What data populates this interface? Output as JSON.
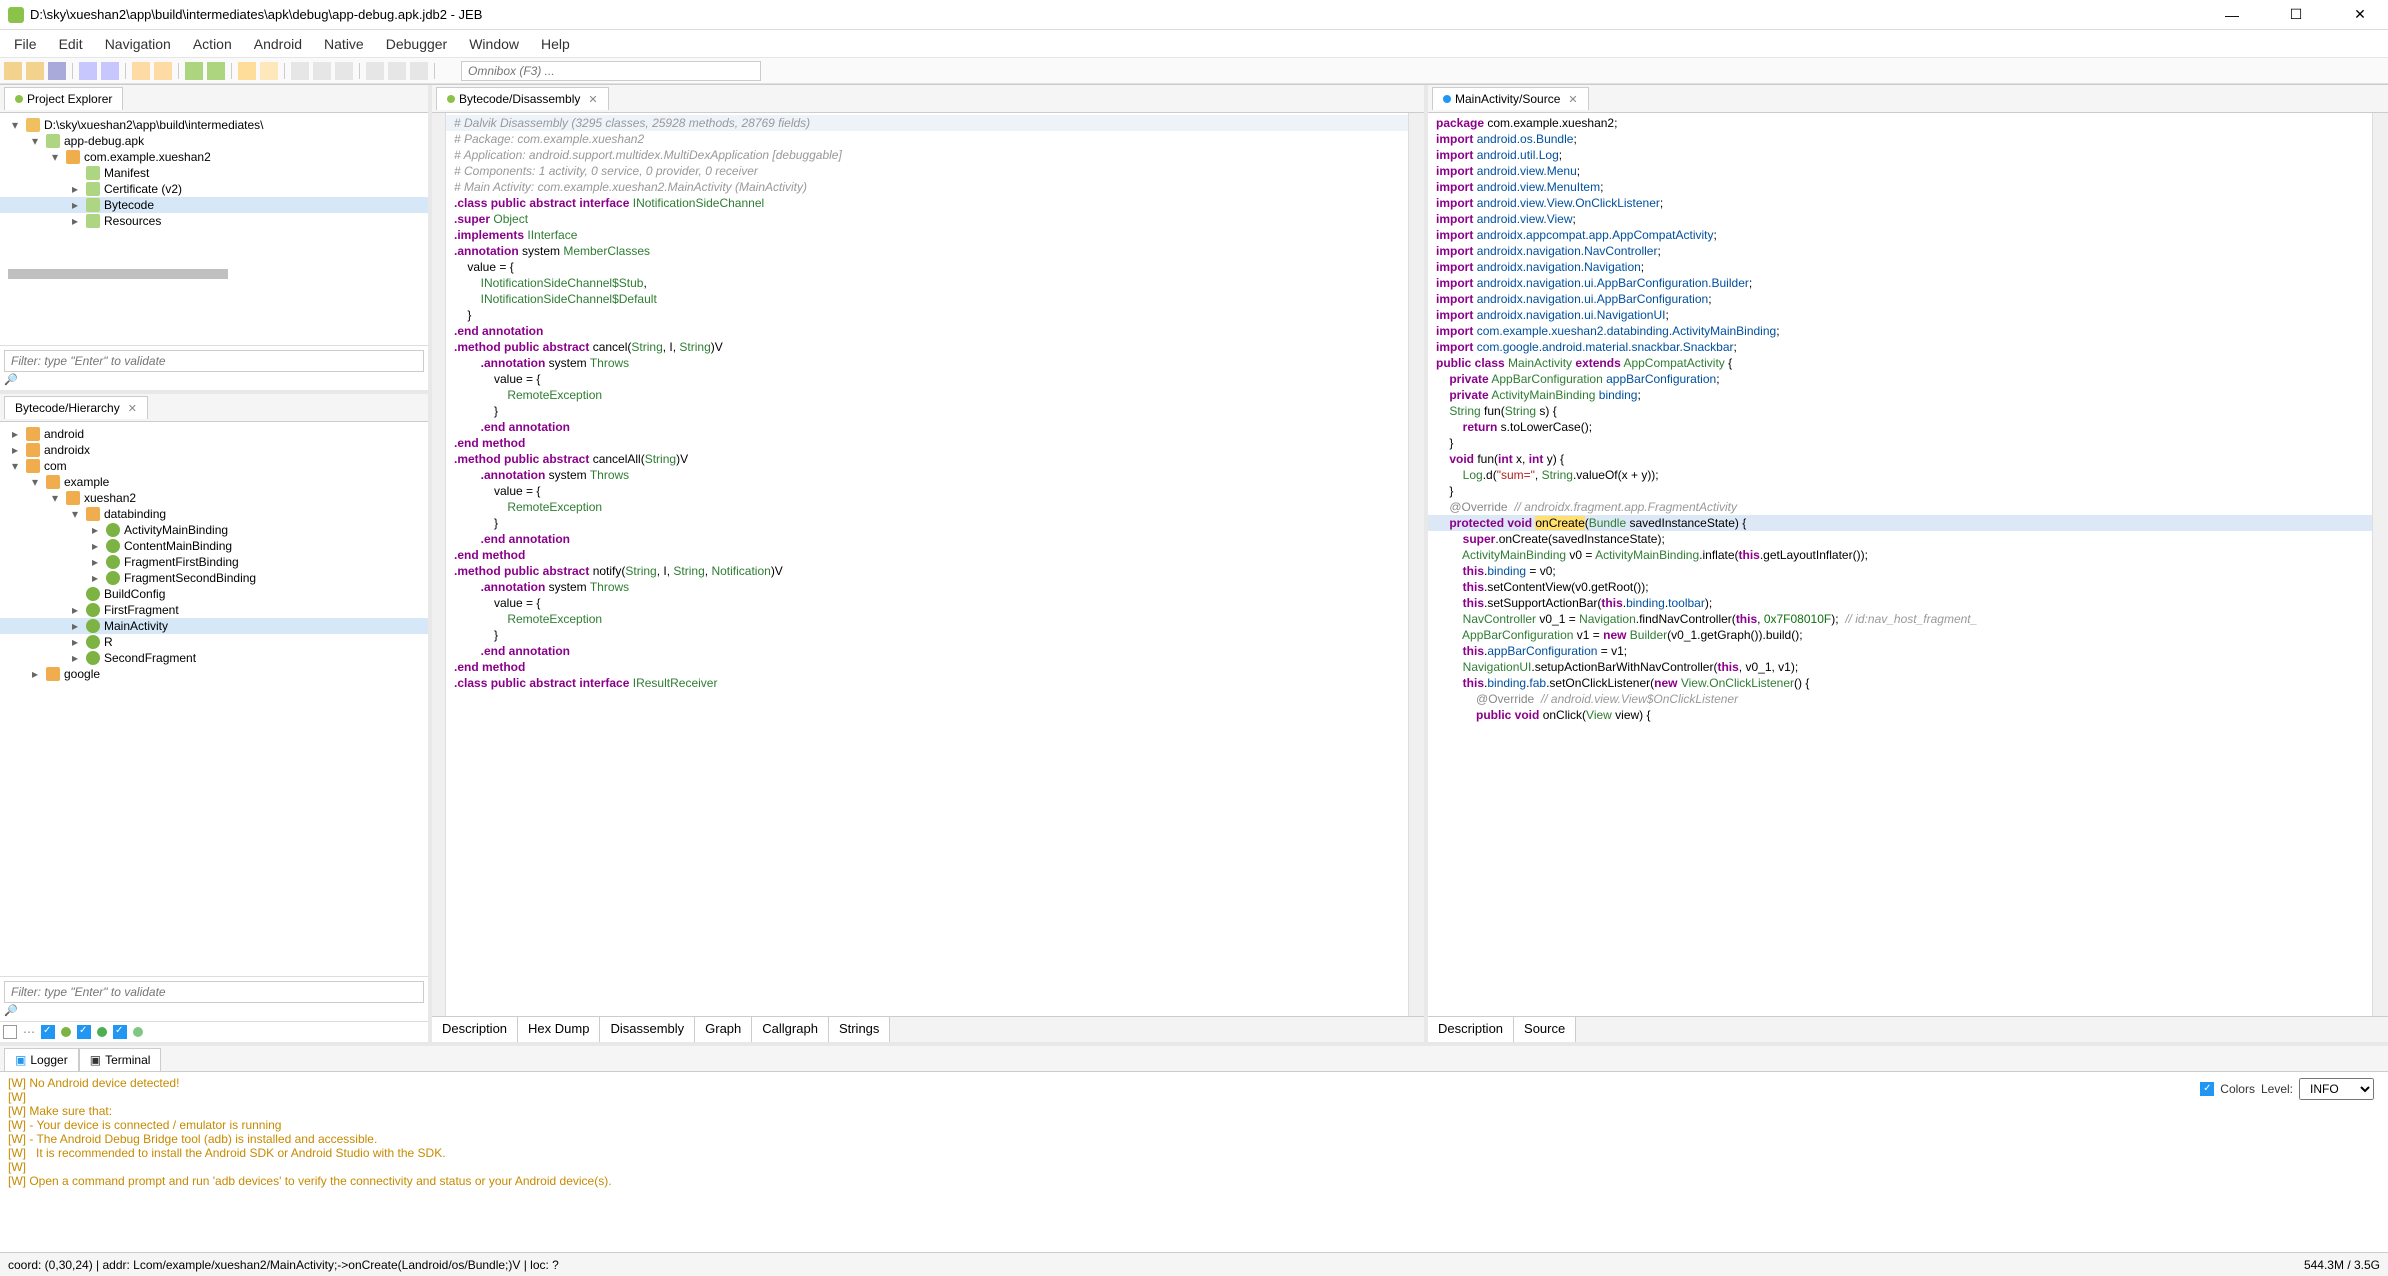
{
  "window": {
    "title": "D:\\sky\\xueshan2\\app\\build\\intermediates\\apk\\debug\\app-debug.apk.jdb2 - JEB"
  },
  "menu": [
    "File",
    "Edit",
    "Navigation",
    "Action",
    "Android",
    "Native",
    "Debugger",
    "Window",
    "Help"
  ],
  "omnibox_placeholder": "Omnibox (F3) ...",
  "panes": {
    "project_explorer": "Project Explorer",
    "bytecode_hier": "Bytecode/Hierarchy",
    "bytecode_dis": "Bytecode/Disassembly",
    "main_src": "MainActivity/Source"
  },
  "explorer_tree": {
    "root": "D:\\sky\\xueshan2\\app\\build\\intermediates\\",
    "apk": "app-debug.apk",
    "pkg": "com.example.xueshan2",
    "items": [
      "Manifest",
      "Certificate (v2)",
      "Bytecode",
      "Resources"
    ],
    "selected": "Bytecode"
  },
  "filter_placeholder": "Filter: type \"Enter\" to validate",
  "hierarchy": {
    "top": [
      "android",
      "androidx",
      "com"
    ],
    "com": [
      "example",
      "google"
    ],
    "example": [
      "xueshan2"
    ],
    "xueshan2": [
      "databinding",
      "BuildConfig",
      "FirstFragment",
      "MainActivity",
      "R",
      "SecondFragment"
    ],
    "databinding": [
      "ActivityMainBinding",
      "ContentMainBinding",
      "FragmentFirstBinding",
      "FragmentSecondBinding"
    ],
    "selected": "MainActivity"
  },
  "bottom_tabs_mid": [
    "Description",
    "Hex Dump",
    "Disassembly",
    "Graph",
    "Callgraph",
    "Strings"
  ],
  "bottom_tabs_right": [
    "Description",
    "Source"
  ],
  "logger": {
    "tabs": [
      "Logger",
      "Terminal"
    ],
    "colors_label": "Colors",
    "level_label": "Level:",
    "level_value": "INFO",
    "lines": [
      "[W] No Android device detected!",
      "[W]",
      "[W] Make sure that:",
      "[W] - Your device is connected / emulator is running",
      "[W] - The Android Debug Bridge tool (adb) is installed and accessible.",
      "[W]   It is recommended to install the Android SDK or Android Studio with the SDK.",
      "[W]",
      "[W] Open a command prompt and run 'adb devices' to verify the connectivity and status or your Android device(s)."
    ]
  },
  "status": {
    "left": "coord: (0,30,24) | addr: Lcom/example/xueshan2/MainActivity;->onCreate(Landroid/os/Bundle;)V | loc: ?",
    "right": "544.3M / 3.5G"
  },
  "disassembly_meta": [
    "# Dalvik Disassembly (3295 classes, 25928 methods, 28769 fields)",
    "# Package: com.example.xueshan2",
    "# Application: android.support.multidex.MultiDexApplication [debuggable]",
    "# Components: 1 activity, 0 service, 0 provider, 0 receiver",
    "# Main Activity: com.example.xueshan2.MainActivity (MainActivity)"
  ],
  "source_pkg": "com.example.xueshan2",
  "imports": [
    "android.os.Bundle",
    "android.util.Log",
    "android.view.Menu",
    "android.view.MenuItem",
    "android.view.View.OnClickListener",
    "android.view.View",
    "androidx.appcompat.app.AppCompatActivity",
    "androidx.navigation.NavController",
    "androidx.navigation.Navigation",
    "androidx.navigation.ui.AppBarConfiguration.Builder",
    "androidx.navigation.ui.AppBarConfiguration",
    "androidx.navigation.ui.NavigationUI",
    "com.example.xueshan2.databinding.ActivityMainBinding",
    "com.google.android.material.snackbar.Snackbar"
  ]
}
